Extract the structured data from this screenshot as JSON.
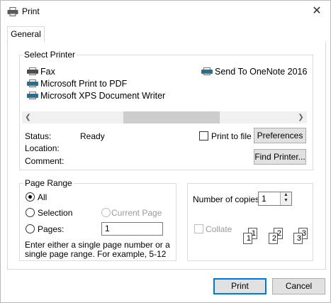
{
  "window": {
    "title": "Print"
  },
  "tabs": [
    {
      "label": "General"
    }
  ],
  "select_printer": {
    "label": "Select Printer",
    "printers": [
      {
        "name": "Fax",
        "icon": "printer-icon"
      },
      {
        "name": "Microsoft Print to PDF",
        "icon": "printer-icon"
      },
      {
        "name": "Microsoft XPS Document Writer",
        "icon": "printer-icon"
      },
      {
        "name": "Send To OneNote 2016",
        "icon": "printer-icon"
      }
    ],
    "status_label": "Status:",
    "status_value": "Ready",
    "location_label": "Location:",
    "comment_label": "Comment:",
    "print_to_file": "Print to file",
    "preferences": "Preferences",
    "find_printer": "Find Printer..."
  },
  "page_range": {
    "label": "Page Range",
    "all": "All",
    "selection": "Selection",
    "current_page": "Current Page",
    "pages": "Pages:",
    "pages_value": "1",
    "hint": "Enter either a single page number or a single page range.  For example, 5-12"
  },
  "copies": {
    "number_label": "Number of copies:",
    "number_value": "1",
    "collate": "Collate",
    "collate_pages": [
      "1",
      "1",
      "2",
      "2",
      "3",
      "3"
    ]
  },
  "buttons": {
    "print": "Print",
    "cancel": "Cancel"
  },
  "colors": {
    "accent": "#0078d7",
    "button_bg": "#e1e1e1",
    "group_border": "#dcdcdc"
  }
}
